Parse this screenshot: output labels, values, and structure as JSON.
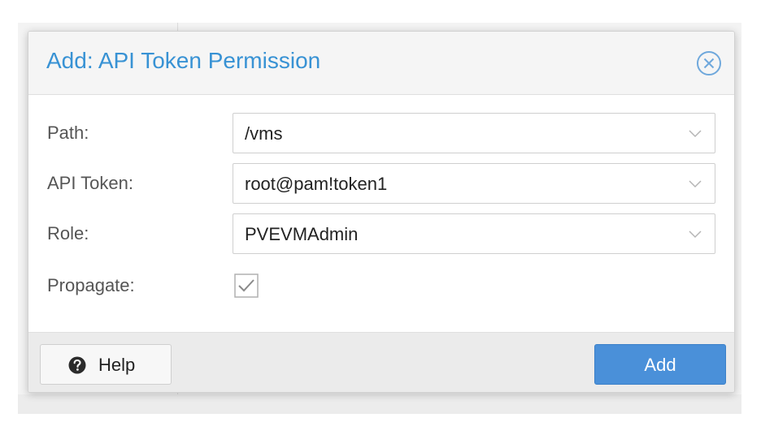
{
  "dialog": {
    "title": "Add: API Token Permission",
    "close_icon": "close-circle-icon"
  },
  "form": {
    "path": {
      "label": "Path:",
      "value": "/vms"
    },
    "token": {
      "label": "API Token:",
      "value": "root@pam!token1"
    },
    "role": {
      "label": "Role:",
      "value": "PVEVMAdmin"
    },
    "propagate": {
      "label": "Propagate:",
      "checked": true
    }
  },
  "footer": {
    "help_label": "Help",
    "help_icon": "question-circle-icon",
    "add_label": "Add"
  },
  "colors": {
    "title": "#3892d4",
    "primary_button": "#4a90d9"
  }
}
